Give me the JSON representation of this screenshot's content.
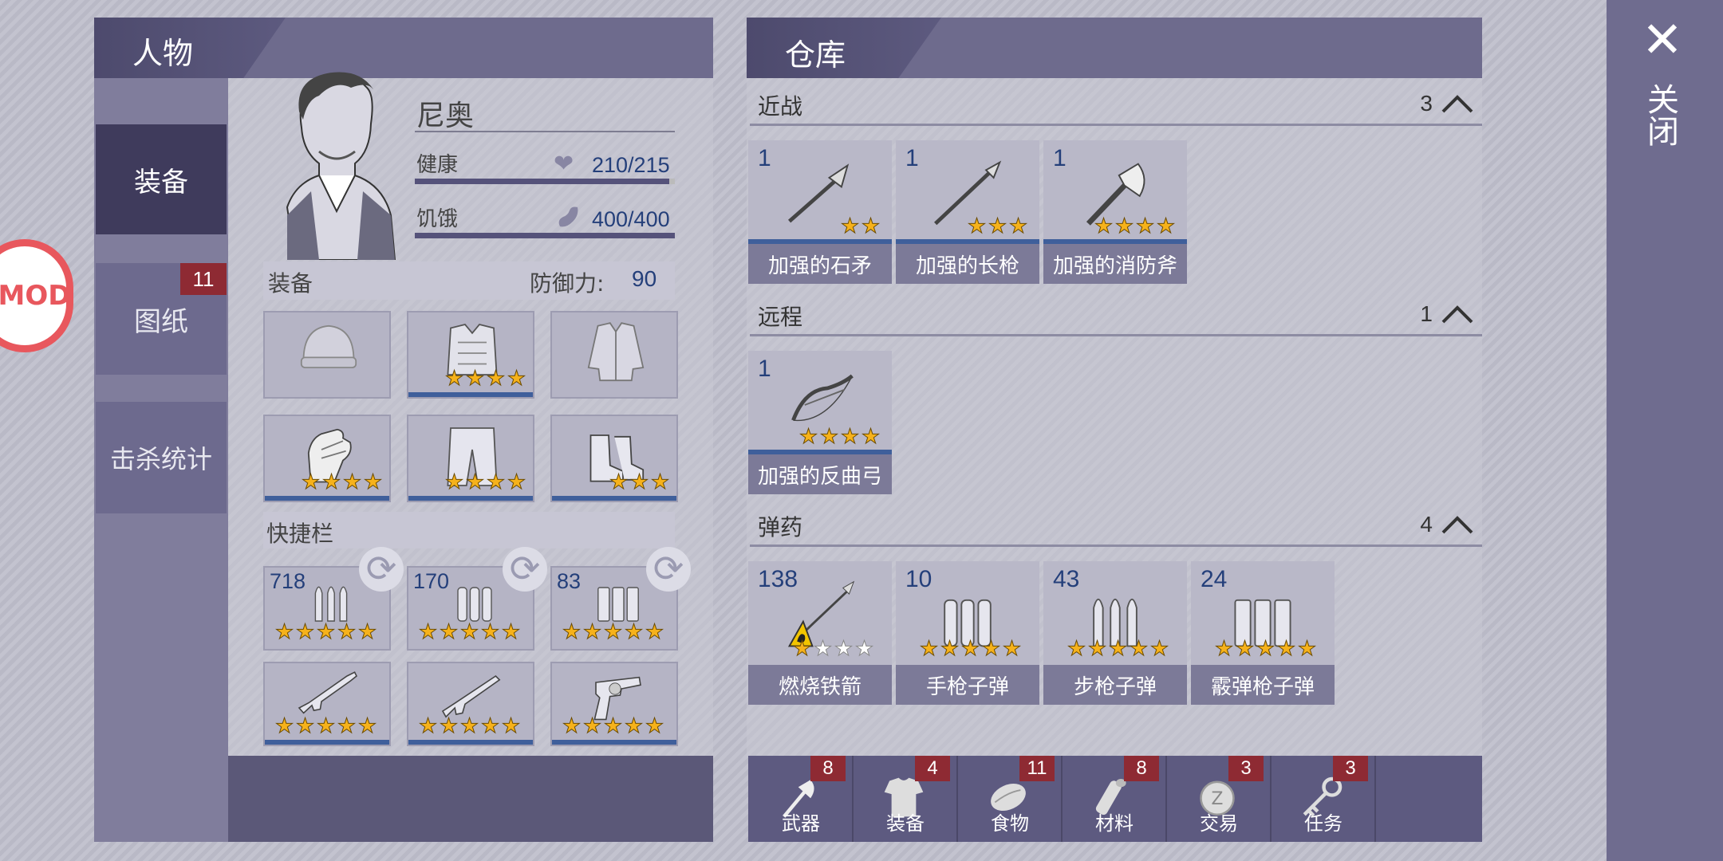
{
  "character_panel": {
    "title": "人物",
    "tabs": [
      {
        "label": "装备",
        "active": true
      },
      {
        "label": "图纸",
        "badge": "11"
      },
      {
        "label": "击杀统计"
      }
    ],
    "name": "尼奥",
    "health": {
      "label": "健康",
      "value": "210/215",
      "fraction": 0.977
    },
    "hunger": {
      "label": "饥饿",
      "value": "400/400",
      "fraction": 1.0
    },
    "equipment": {
      "label": "装备",
      "defense_label": "防御力:",
      "defense_value": "90",
      "slots": [
        {
          "icon": "beanie-icon",
          "stars": 0
        },
        {
          "icon": "armor-vest-icon",
          "stars": 4
        },
        {
          "icon": "jacket-icon",
          "stars": 0
        },
        {
          "icon": "gloves-icon",
          "stars": 4
        },
        {
          "icon": "pants-icon",
          "stars": 4
        },
        {
          "icon": "boots-icon",
          "stars": 3
        }
      ]
    },
    "quickbar": {
      "label": "快捷栏",
      "ammo": [
        {
          "count": "718",
          "stars": 5,
          "icon": "rifle-ammo-icon"
        },
        {
          "count": "170",
          "stars": 5,
          "icon": "pistol-ammo-icon"
        },
        {
          "count": "83",
          "stars": 5,
          "icon": "shotgun-ammo-icon"
        }
      ],
      "weapons": [
        {
          "stars": 5,
          "icon": "rifle-icon"
        },
        {
          "stars": 5,
          "icon": "shotgun-icon"
        },
        {
          "stars": 5,
          "icon": "revolver-icon"
        }
      ]
    }
  },
  "warehouse_panel": {
    "title": "仓库",
    "sections": [
      {
        "name": "近战",
        "count": "3",
        "items": [
          {
            "count": "1",
            "stars": 2,
            "label": "加强的石矛",
            "icon": "spear-icon"
          },
          {
            "count": "1",
            "stars": 3,
            "label": "加强的长枪",
            "icon": "long-spear-icon"
          },
          {
            "count": "1",
            "stars": 4,
            "label": "加强的消防斧",
            "icon": "fire-axe-icon"
          }
        ]
      },
      {
        "name": "远程",
        "count": "1",
        "items": [
          {
            "count": "1",
            "stars": 4,
            "label": "加强的反曲弓",
            "icon": "recurve-bow-icon"
          }
        ]
      },
      {
        "name": "弹药",
        "count": "4",
        "items": [
          {
            "count": "138",
            "stars": 1,
            "max_stars": 4,
            "label": "燃烧铁箭",
            "icon": "fire-arrow-icon"
          },
          {
            "count": "10",
            "stars": 5,
            "label": "手枪子弹",
            "icon": "pistol-ammo-icon"
          },
          {
            "count": "43",
            "stars": 5,
            "label": "步枪子弹",
            "icon": "rifle-ammo-icon"
          },
          {
            "count": "24",
            "stars": 5,
            "label": "霰弹枪子弹",
            "icon": "shotgun-ammo-icon"
          }
        ]
      }
    ],
    "bottom_tabs": [
      {
        "label": "武器",
        "badge": "8",
        "icon": "axe-icon"
      },
      {
        "label": "装备",
        "badge": "4",
        "icon": "shirt-icon"
      },
      {
        "label": "食物",
        "badge": "11",
        "icon": "meat-icon"
      },
      {
        "label": "材料",
        "badge": "8",
        "icon": "log-icon"
      },
      {
        "label": "交易",
        "badge": "3",
        "icon": "coin-icon"
      },
      {
        "label": "任务",
        "badge": "3",
        "icon": "key-icon"
      }
    ]
  },
  "close": {
    "label": "关闭"
  },
  "mod_badge": "MOD"
}
